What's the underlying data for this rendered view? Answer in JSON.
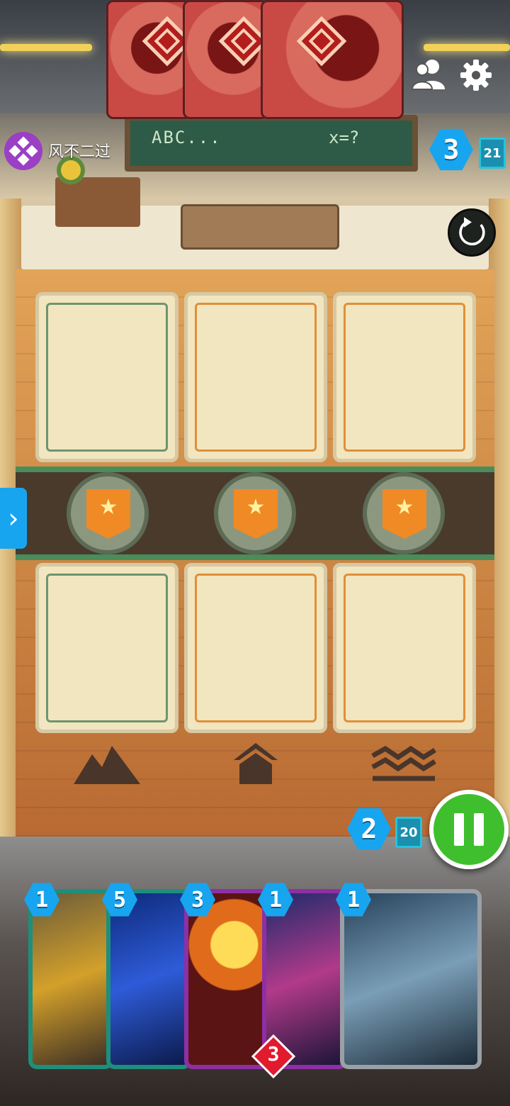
{
  "opponent": {
    "name": "风不二过",
    "energy": "3",
    "deck_count": "21"
  },
  "blackboard": {
    "text_left": "ABC...",
    "text_right": "x=?"
  },
  "player": {
    "energy": "2",
    "deck_count": "20"
  },
  "locations": [
    {
      "name": "location-left",
      "icon": "star-banner-icon"
    },
    {
      "name": "location-middle",
      "icon": "star-banner-icon"
    },
    {
      "name": "location-right",
      "icon": "star-banner-icon"
    }
  ],
  "terrain_icons": [
    "mountains-icon",
    "house-icon",
    "water-waves-icon"
  ],
  "hand": [
    {
      "cost": "1",
      "frame_color": "#1d8f7c"
    },
    {
      "cost": "5",
      "frame_color": "#1d8f7c"
    },
    {
      "cost": "3",
      "frame_color": "#8e2fa5"
    },
    {
      "cost": "1",
      "frame_color": "#8e2fa5",
      "power": "3"
    },
    {
      "cost": "1",
      "frame_color": "#9aa0a6"
    }
  ],
  "colors": {
    "accent_blue": "#17a5f0",
    "pause_green": "#3fbf2d"
  }
}
